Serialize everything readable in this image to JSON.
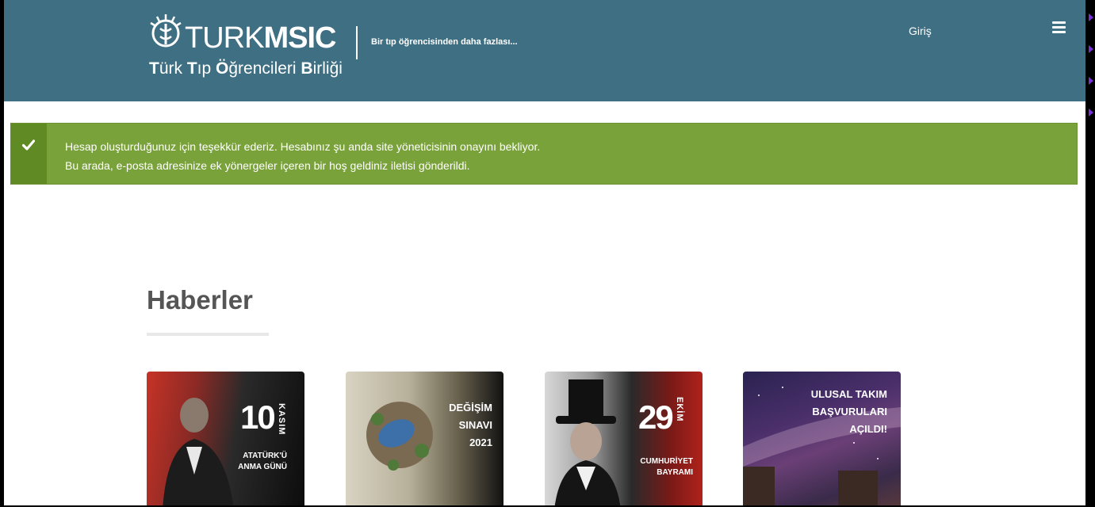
{
  "header": {
    "logo_word_thin": "TURK",
    "logo_word_bold": "MSIC",
    "logo_subtitle_1": "T",
    "logo_subtitle_2": "ürk ",
    "logo_subtitle_3": "T",
    "logo_subtitle_4": "ıp ",
    "logo_subtitle_5": "Ö",
    "logo_subtitle_6": "ğrencileri ",
    "logo_subtitle_7": "B",
    "logo_subtitle_8": "irliği",
    "slogan": "Bir tıp öğrencisinden daha fazlası...",
    "login_label": "Giriş",
    "background_color": "#3e6f83"
  },
  "alert": {
    "line1": "Hesap oluşturduğunuz için teşekkür ederiz. Hesabınız şu anda site yöneticisinin onayını bekliyor.",
    "line2": "Bu arada, e-posta adresinize ek yönergeler içeren bir hoş geldiniz iletisi gönderildi.",
    "icon": "check-icon",
    "color": "#7aa23a"
  },
  "news": {
    "title": "Haberler",
    "cards": [
      {
        "number": "10",
        "vertical": "KASIM",
        "caption_1": "ATATÜRK'Ü",
        "caption_2": "ANMA GÜNÜ"
      },
      {
        "line_1": "DEĞİŞİM",
        "line_2": "SINAVI",
        "line_3": "2021"
      },
      {
        "number": "29",
        "vertical": "EKİM",
        "caption_1": "CUMHURİYET",
        "caption_2": "BAYRAMI"
      },
      {
        "line_1": "ULUSAL TAKIM",
        "line_2": "BAŞVURULARI",
        "line_3": "AÇILDI!"
      }
    ]
  }
}
